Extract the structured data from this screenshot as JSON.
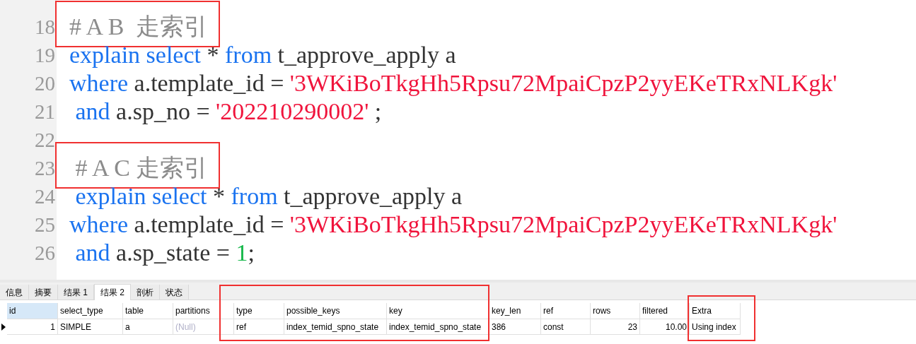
{
  "editor": {
    "lines": [
      {
        "number": "18",
        "boxed": true,
        "tokens": [
          {
            "kind": "comment",
            "text": "# A B  走索引"
          }
        ]
      },
      {
        "number": "19",
        "tokens": [
          {
            "kind": "keyword",
            "text": "explain select"
          },
          {
            "kind": "plain",
            "text": " * "
          },
          {
            "kind": "keyword",
            "text": "from"
          },
          {
            "kind": "plain",
            "text": " t_approve_apply a"
          }
        ]
      },
      {
        "number": "20",
        "tokens": [
          {
            "kind": "keyword",
            "text": "where"
          },
          {
            "kind": "plain",
            "text": " a.template_id = "
          },
          {
            "kind": "string",
            "text": "'3WKiBoTkgHh5Rpsu72MpaiCpzP2yyEKeTRxNLKgk'"
          }
        ]
      },
      {
        "number": "21",
        "tokens": [
          {
            "kind": "keyword",
            "text": " and"
          },
          {
            "kind": "plain",
            "text": " a.sp_no = "
          },
          {
            "kind": "string",
            "text": "'202210290002'"
          },
          {
            "kind": "plain",
            "text": " ;"
          }
        ]
      },
      {
        "number": "22"
      },
      {
        "number": "23",
        "boxed": true,
        "tokens": [
          {
            "kind": "comment",
            "text": " # A C 走索引"
          }
        ]
      },
      {
        "number": "24",
        "tokens": [
          {
            "kind": "keyword",
            "text": " explain select"
          },
          {
            "kind": "plain",
            "text": " * "
          },
          {
            "kind": "keyword",
            "text": "from"
          },
          {
            "kind": "plain",
            "text": " t_approve_apply a"
          }
        ]
      },
      {
        "number": "25",
        "tokens": [
          {
            "kind": "keyword",
            "text": "where"
          },
          {
            "kind": "plain",
            "text": " a.template_id = "
          },
          {
            "kind": "string",
            "text": "'3WKiBoTkgHh5Rpsu72MpaiCpzP2yyEKeTRxNLKgk'"
          }
        ]
      },
      {
        "number": "26",
        "tokens": [
          {
            "kind": "keyword",
            "text": " and"
          },
          {
            "kind": "plain",
            "text": " a.sp_state = "
          },
          {
            "kind": "number",
            "text": "1"
          },
          {
            "kind": "plain",
            "text": ";"
          }
        ]
      }
    ]
  },
  "results": {
    "tabs": [
      {
        "label": "信息",
        "selected": false
      },
      {
        "label": "摘要",
        "selected": false
      },
      {
        "label": "结果 1",
        "selected": false
      },
      {
        "label": "结果 2",
        "selected": true
      },
      {
        "label": "剖析",
        "selected": false
      },
      {
        "label": "状态",
        "selected": false
      }
    ],
    "columns": [
      {
        "label": "id",
        "selected": true
      },
      {
        "label": "select_type",
        "selected": false
      },
      {
        "label": "table",
        "selected": false
      },
      {
        "label": "partitions",
        "selected": false
      },
      {
        "label": "type",
        "selected": false
      },
      {
        "label": "possible_keys",
        "selected": false
      },
      {
        "label": "key",
        "selected": false
      },
      {
        "label": "key_len",
        "selected": false
      },
      {
        "label": "ref",
        "selected": false
      },
      {
        "label": "rows",
        "selected": false
      },
      {
        "label": "filtered",
        "selected": false
      },
      {
        "label": "Extra",
        "selected": false
      }
    ],
    "rows": [
      {
        "current": true,
        "cells": [
          {
            "kind": "number",
            "text": "1"
          },
          {
            "kind": "text",
            "text": "SIMPLE"
          },
          {
            "kind": "text",
            "text": "a"
          },
          {
            "kind": "null",
            "text": "(Null)"
          },
          {
            "kind": "text",
            "text": "ref"
          },
          {
            "kind": "text",
            "text": "index_temid_spno_state"
          },
          {
            "kind": "text",
            "text": "index_temid_spno_state"
          },
          {
            "kind": "text",
            "text": "386"
          },
          {
            "kind": "text",
            "text": "const"
          },
          {
            "kind": "number",
            "text": "23"
          },
          {
            "kind": "number",
            "text": "10.00"
          },
          {
            "kind": "text",
            "text": "Using index"
          }
        ]
      }
    ]
  }
}
